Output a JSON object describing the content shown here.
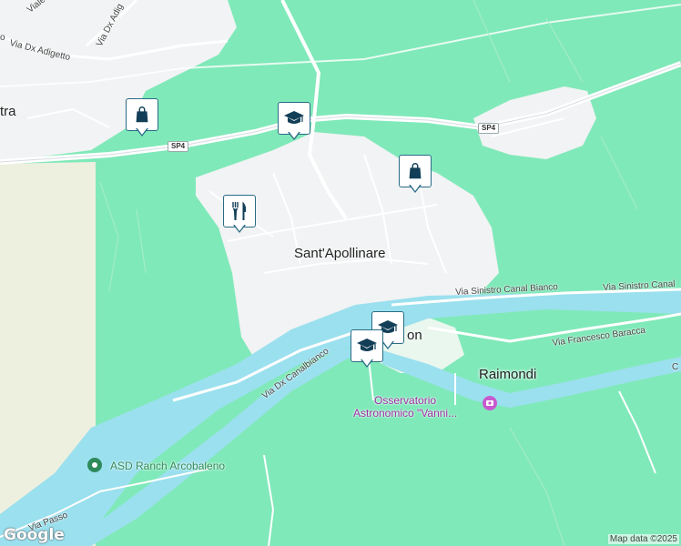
{
  "map": {
    "place_labels": {
      "sant_apollinare": "Sant'Apollinare",
      "raimondi": "Raimondi",
      "partial_left": "tra",
      "partial_center": "on"
    },
    "road_labels": {
      "viale_do": "Viale Do",
      "via_dx_adig": "Via Dx Adig",
      "via_dx_adigetto": "Via Dx Adigetto",
      "partial_o": "o",
      "via_sinistro_canal_bianco": "Via Sinistro Canal Bianco",
      "via_sinistro_canal": "Via Sinistro Canal",
      "via_francesco_baracca": "Via Francesco Baracca",
      "via_dx_canalbianco": "Via Dx Canalbianco",
      "via_passo": "Via Passo",
      "partial_c": "C"
    },
    "route_shields": {
      "sp4_left": "SP4",
      "sp4_right": "SP4"
    },
    "poi_labels": {
      "osservatorio_line1": "Osservatorio",
      "osservatorio_line2": "Astronomico \"Vanni...",
      "asd_ranch": "ASD Ranch Arcobaleno"
    },
    "markers": [
      {
        "type": "shopping-bag",
        "name": "shopping-marker-1"
      },
      {
        "type": "graduation-cap",
        "name": "school-marker-1"
      },
      {
        "type": "shopping-bag",
        "name": "shopping-marker-2"
      },
      {
        "type": "restaurant",
        "name": "restaurant-marker"
      },
      {
        "type": "graduation-cap",
        "name": "school-marker-2"
      },
      {
        "type": "graduation-cap",
        "name": "school-marker-3"
      }
    ],
    "attribution": "Map data ©2025",
    "google_logo": "Google"
  },
  "colors": {
    "land": "#7fe8b8",
    "urban": "#f1f3f4",
    "water": "#9be0ee",
    "marker_icon": "#123f57",
    "poi_purple": "#9b2fa3",
    "poi_green": "#2e8a5b"
  }
}
